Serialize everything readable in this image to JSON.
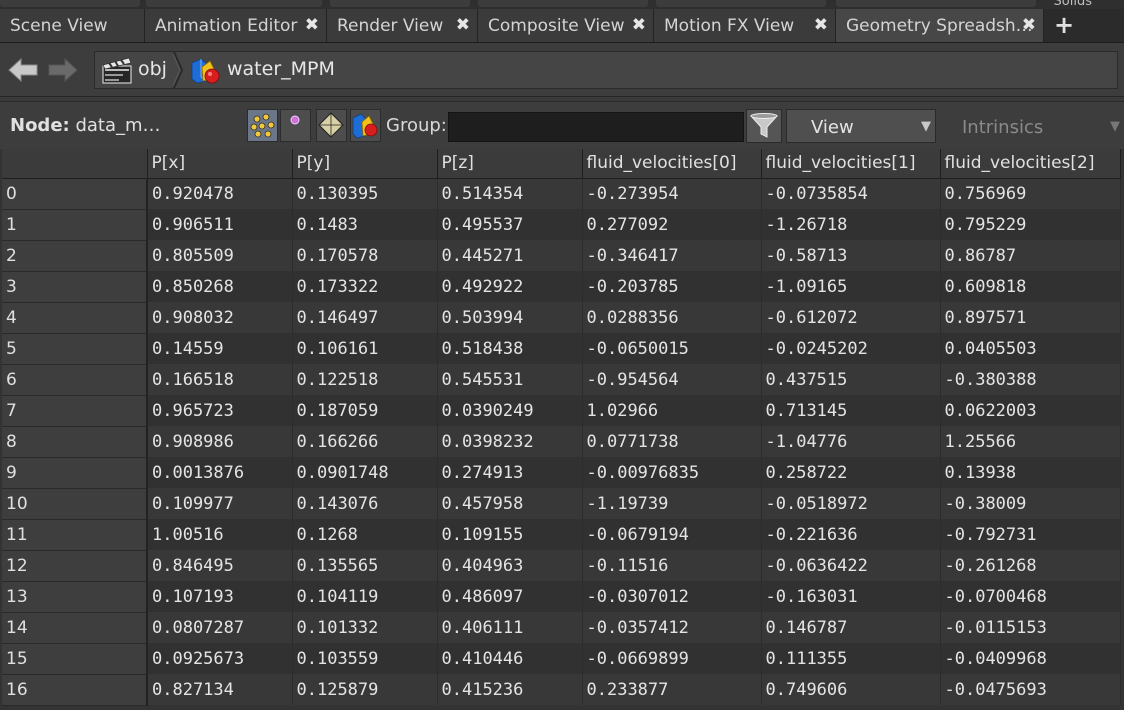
{
  "top_strip": {
    "partial_label": "Solids"
  },
  "tabs": [
    {
      "label": "Scene View",
      "active": false
    },
    {
      "label": "Animation Editor",
      "active": false
    },
    {
      "label": "Render View",
      "active": false
    },
    {
      "label": "Composite View",
      "active": false
    },
    {
      "label": "Motion FX View",
      "active": false
    },
    {
      "label": "Geometry Spreadsh…",
      "active": true
    }
  ],
  "tab_close_glyph": "✖",
  "tab_add_glyph": "+",
  "path": {
    "segments": [
      {
        "label": "obj",
        "icon": "clapperboard-icon"
      },
      {
        "label": "water_MPM",
        "icon": "geometry-object-icon"
      }
    ]
  },
  "toolbar": {
    "node_label": "Node:",
    "node_value": "data_m…",
    "group_label": "Group:",
    "group_value": "",
    "view_label": "View",
    "intrinsics_label": "Intrinsics",
    "component_buttons": [
      "points-icon",
      "vertices-icon",
      "primitives-icon",
      "detail-icon"
    ]
  },
  "colors": {
    "background": "#3a3a3a",
    "tab_active": "#474747",
    "selected_button": "#6b7689",
    "text": "#e4e4e4"
  },
  "spreadsheet": {
    "columns": [
      "",
      "P[x]",
      "P[y]",
      "P[z]",
      "fluid_velocities[0]",
      "fluid_velocities[1]",
      "fluid_velocities[2]"
    ],
    "rows": [
      [
        "0",
        "0.920478",
        "0.130395",
        "0.514354",
        "-0.273954",
        "-0.0735854",
        "0.756969"
      ],
      [
        "1",
        "0.906511",
        "0.1483",
        "0.495537",
        "0.277092",
        "-1.26718",
        "0.795229"
      ],
      [
        "2",
        "0.805509",
        "0.170578",
        "0.445271",
        "-0.346417",
        "-0.58713",
        "0.86787"
      ],
      [
        "3",
        "0.850268",
        "0.173322",
        "0.492922",
        "-0.203785",
        "-1.09165",
        "0.609818"
      ],
      [
        "4",
        "0.908032",
        "0.146497",
        "0.503994",
        "0.0288356",
        "-0.612072",
        "0.897571"
      ],
      [
        "5",
        "0.14559",
        "0.106161",
        "0.518438",
        "-0.0650015",
        "-0.0245202",
        "0.0405503"
      ],
      [
        "6",
        "0.166518",
        "0.122518",
        "0.545531",
        "-0.954564",
        "0.437515",
        "-0.380388"
      ],
      [
        "7",
        "0.965723",
        "0.187059",
        "0.0390249",
        "1.02966",
        "0.713145",
        "0.0622003"
      ],
      [
        "8",
        "0.908986",
        "0.166266",
        "0.0398232",
        "0.0771738",
        "-1.04776",
        "1.25566"
      ],
      [
        "9",
        "0.0013876",
        "0.0901748",
        "0.274913",
        "-0.00976835",
        "0.258722",
        "0.13938"
      ],
      [
        "10",
        "0.109977",
        "0.143076",
        "0.457958",
        "-1.19739",
        "-0.0518972",
        "-0.38009"
      ],
      [
        "11",
        "1.00516",
        "0.1268",
        "0.109155",
        "-0.0679194",
        "-0.221636",
        "-0.792731"
      ],
      [
        "12",
        "0.846495",
        "0.135565",
        "0.404963",
        "-0.11516",
        "-0.0636422",
        "-0.261268"
      ],
      [
        "13",
        "0.107193",
        "0.104119",
        "0.486097",
        "-0.0307012",
        "-0.163031",
        "-0.0700468"
      ],
      [
        "14",
        "0.0807287",
        "0.101332",
        "0.406111",
        "-0.0357412",
        "0.146787",
        "-0.0115153"
      ],
      [
        "15",
        "0.0925673",
        "0.103559",
        "0.410446",
        "-0.0669899",
        "0.111355",
        "-0.0409968"
      ],
      [
        "16",
        "0.827134",
        "0.125879",
        "0.415236",
        "0.233877",
        "0.749606",
        "-0.0475693"
      ]
    ]
  }
}
